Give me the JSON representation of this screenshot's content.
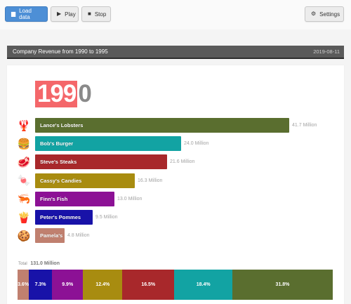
{
  "toolbar": {
    "load_label": "Load data",
    "play_label": "Play",
    "stop_label": "Stop",
    "settings_label": "Settings"
  },
  "title": "Company Revenue from 1990 to 1995",
  "date": "2019-08-11",
  "year": {
    "highlight": "199",
    "rest": "0"
  },
  "total": {
    "label": "Total",
    "value": "131.0 Million"
  },
  "colors": {
    "lobsters": "#5a6e2f",
    "burger": "#12a3a3",
    "steaks": "#a8282b",
    "candies": "#a88c10",
    "fish": "#8c1195",
    "pommes": "#1812a8",
    "pamela": "#c0806f"
  },
  "chart_data": {
    "type": "bar",
    "orientation": "horizontal",
    "categories": [
      "Lance's Lobsters",
      "Bob's Burger",
      "Steve's Steaks",
      "Cassy's Candies",
      "Finn's Fish",
      "Peter's Pommes",
      "Pamela's"
    ],
    "values": [
      41.7,
      24.0,
      21.6,
      16.3,
      13.0,
      9.5,
      4.8
    ],
    "value_labels": [
      "41.7 Million",
      "24.0 Million",
      "21.6 Million",
      "16.3 Million",
      "13.0 Million",
      "9.5 Million",
      "4.8 Million"
    ],
    "icons": [
      "lobster-icon",
      "burger-icon",
      "steak-icon",
      "candy-icon",
      "fish-icon",
      "fries-icon",
      "cookie-icon"
    ],
    "glyphs": [
      "🦞",
      "🍔",
      "🥩",
      "🍬",
      "🦐",
      "🍟",
      "🍪"
    ],
    "share": {
      "order": [
        "Pamela's",
        "Peter's Pommes",
        "Finn's Fish",
        "Cassy's Candies",
        "Steve's Steaks",
        "Bob's Burger",
        "Lance's Lobsters"
      ],
      "values": [
        3.6,
        7.3,
        9.9,
        12.4,
        16.5,
        18.4,
        31.8
      ],
      "labels": [
        "3.6%",
        "7.3%",
        "9.9%",
        "12.4%",
        "16.5%",
        "18.4%",
        "31.8%"
      ]
    }
  }
}
